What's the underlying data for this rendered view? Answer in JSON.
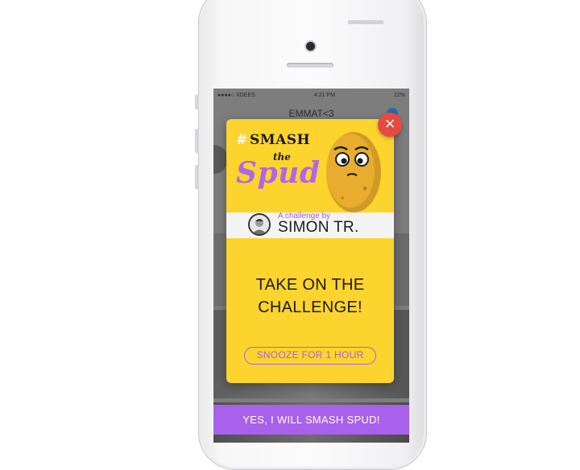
{
  "status_bar": {
    "carrier": "●●●●○ XDEES",
    "time": "4:21 PM",
    "battery": "22%"
  },
  "nav": {
    "title": "EMMAT<3"
  },
  "modal": {
    "logo": {
      "hash": "#",
      "smash": "SMASH",
      "the": "the",
      "spud": "Spud"
    },
    "challenger": {
      "caption": "A challenge by",
      "name": "SIMON TR."
    },
    "headline_line1": "TAKE ON THE",
    "headline_line2": "CHALLENGE!",
    "snooze_label": "SNOOZE FOR 1 HOUR",
    "close_label": "×"
  },
  "cta_label": "YES, I WILL SMASH SPUD!",
  "colors": {
    "card_yellow": "#fdd42e",
    "accent_purple": "#a861ea",
    "close_red": "#e64b3f"
  }
}
